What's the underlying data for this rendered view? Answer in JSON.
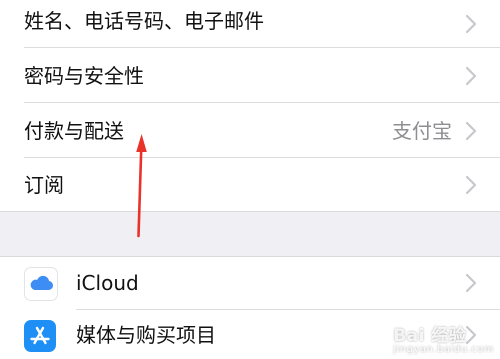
{
  "settings_group_1": {
    "items": [
      {
        "label": "姓名、电话号码、电子邮件",
        "value": ""
      },
      {
        "label": "密码与安全性",
        "value": ""
      },
      {
        "label": "付款与配送",
        "value": "支付宝"
      },
      {
        "label": "订阅",
        "value": ""
      }
    ]
  },
  "settings_group_2": {
    "items": [
      {
        "label": "iCloud",
        "icon": "icloud-icon"
      },
      {
        "label": "媒体与购买项目",
        "icon": "app-store-icon"
      }
    ]
  },
  "watermark": {
    "text": "Bai 经验",
    "sub": "jingyan.baidu.com"
  },
  "colors": {
    "annotation": "#e8322a",
    "icloud_blue": "#3d8df5",
    "appstore_blue": "#1e8ff5",
    "chevron": "#c7c7cc",
    "secondary_text": "#8e8e93"
  }
}
